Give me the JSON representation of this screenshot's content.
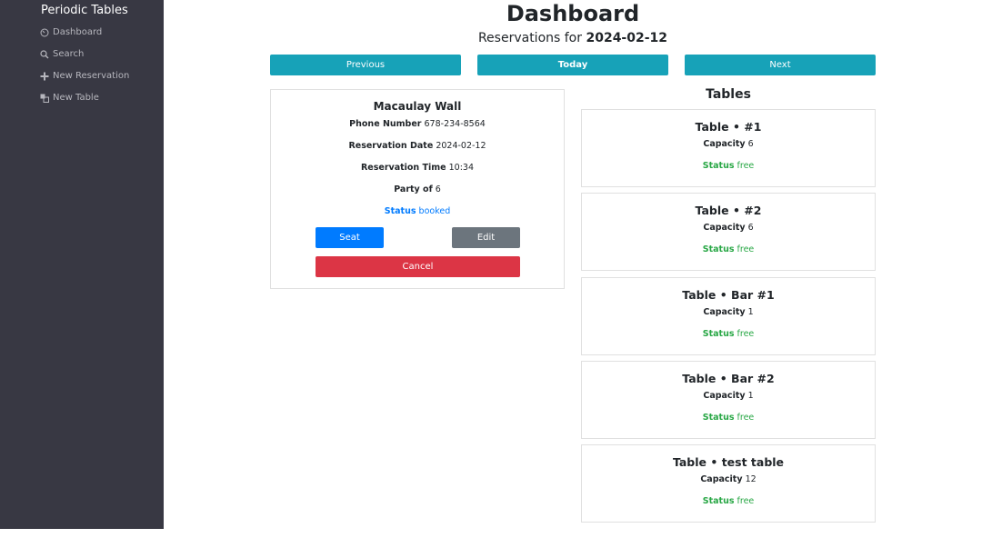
{
  "sidebar": {
    "brand": "Periodic Tables",
    "items": [
      {
        "label": "Dashboard",
        "icon": "dashboard-icon"
      },
      {
        "label": "Search",
        "icon": "search-icon"
      },
      {
        "label": "New Reservation",
        "icon": "plus-icon"
      },
      {
        "label": "New Table",
        "icon": "table-icon"
      }
    ]
  },
  "header": {
    "title": "Dashboard",
    "subtitle_prefix": "Reservations for",
    "date": "2024-02-12"
  },
  "nav_buttons": {
    "previous": "Previous",
    "today": "Today",
    "next": "Next"
  },
  "reservation": {
    "name": "Macaulay Wall",
    "phone_label": "Phone Number",
    "phone": "678-234-8564",
    "date_label": "Reservation Date",
    "date": "2024-02-12",
    "time_label": "Reservation Time",
    "time": "10:34",
    "party_label": "Party of",
    "party": "6",
    "status_label": "Status",
    "status": "booked",
    "seat_label": "Seat",
    "edit_label": "Edit",
    "cancel_label": "Cancel"
  },
  "tables_title": "Tables",
  "tables": [
    {
      "name": "Table • #1",
      "capacity_label": "Capacity",
      "capacity": "6",
      "status_label": "Status",
      "status": "free"
    },
    {
      "name": "Table • #2",
      "capacity_label": "Capacity",
      "capacity": "6",
      "status_label": "Status",
      "status": "free"
    },
    {
      "name": "Table • Bar #1",
      "capacity_label": "Capacity",
      "capacity": "1",
      "status_label": "Status",
      "status": "free"
    },
    {
      "name": "Table • Bar #2",
      "capacity_label": "Capacity",
      "capacity": "1",
      "status_label": "Status",
      "status": "free"
    },
    {
      "name": "Table • test table",
      "capacity_label": "Capacity",
      "capacity": "12",
      "status_label": "Status",
      "status": "free"
    }
  ],
  "colors": {
    "sidebar_bg": "#383843",
    "info": "#17a2b8",
    "primary": "#007bff",
    "secondary": "#6c757d",
    "danger": "#dc3545",
    "success": "#28a745"
  }
}
